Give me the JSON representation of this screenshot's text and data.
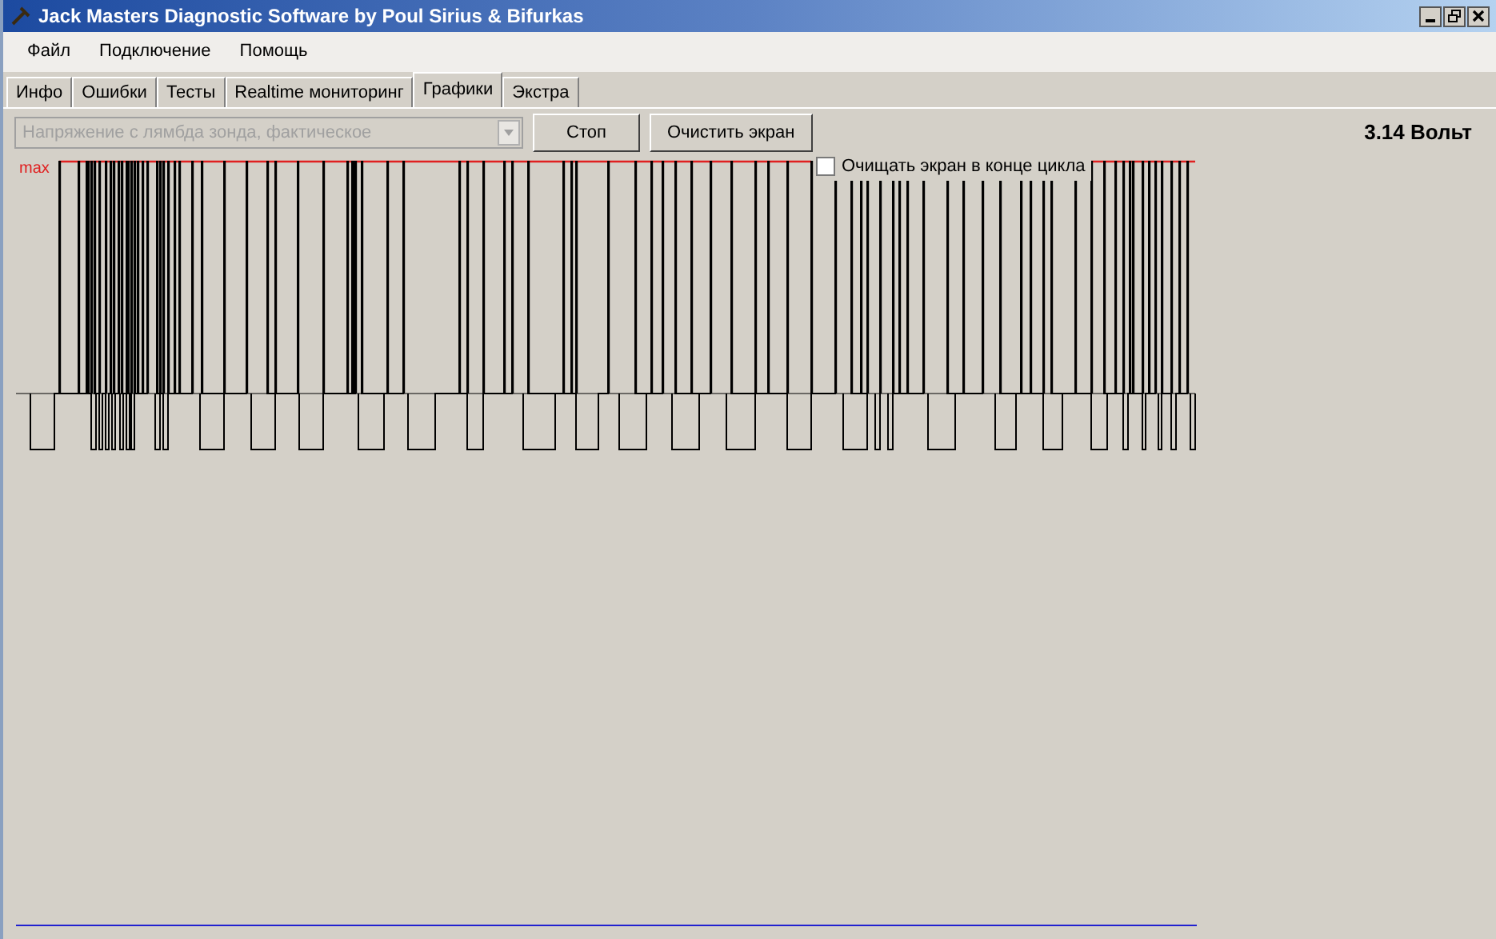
{
  "window": {
    "title": "Jack Masters Diagnostic Software by Poul Sirius & Bifurkas"
  },
  "menu": [
    "Файл",
    "Подключение",
    "Помощь"
  ],
  "tabs": [
    {
      "label": "Инфо",
      "selected": false
    },
    {
      "label": "Ошибки",
      "selected": false
    },
    {
      "label": "Тесты",
      "selected": false
    },
    {
      "label": "Realtime мониторинг",
      "selected": false
    },
    {
      "label": "Графики",
      "selected": true
    },
    {
      "label": "Экстра",
      "selected": false
    }
  ],
  "signal_select": {
    "value": "Напряжение с лямбда зонда, фактическое",
    "disabled": true
  },
  "buttons": [
    "Стоп",
    "Очистить экран"
  ],
  "reading": "3.14 Вольт",
  "graph": {
    "max_label": "max",
    "clear_at_cycle_end": {
      "label": "Очищать экран в конце цикла",
      "checked": false
    }
  }
}
